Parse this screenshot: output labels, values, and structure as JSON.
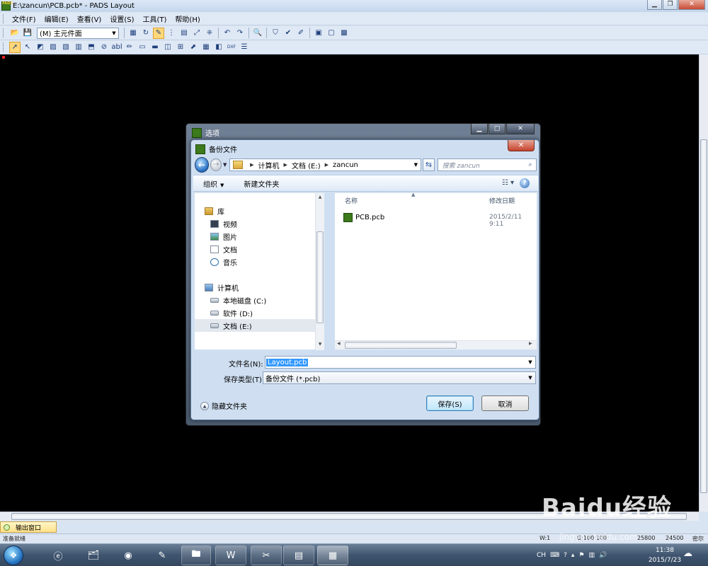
{
  "window": {
    "title": "E:\\zancun\\PCB.pcb* - PADS Layout",
    "app_icon_label": "PADS",
    "controls": [
      "minimize",
      "maximize",
      "close"
    ]
  },
  "menubar": {
    "items": [
      "文件(F)",
      "编辑(E)",
      "查看(V)",
      "设置(S)",
      "工具(T)",
      "帮助(H)"
    ]
  },
  "toolbar1": {
    "layer_combo": "(M) 主元件面"
  },
  "toolbar2": {
    "text_tool_label": "abl",
    "dxf_tool_label": "DXF"
  },
  "options_dialog": {
    "title": "选项"
  },
  "save_dialog": {
    "title": "备份文件",
    "breadcrumb": [
      "计算机",
      "文档 (E:)",
      "zancun"
    ],
    "search_placeholder": "搜索 zancun",
    "commands": {
      "organize": "组织",
      "new_folder": "新建文件夹"
    },
    "nav_tree": [
      {
        "label": "库",
        "icon": "library-icon",
        "level": 0
      },
      {
        "label": "视频",
        "icon": "video-icon",
        "level": 1
      },
      {
        "label": "图片",
        "icon": "picture-icon",
        "level": 1
      },
      {
        "label": "文档",
        "icon": "document-icon",
        "level": 1
      },
      {
        "label": "音乐",
        "icon": "music-icon",
        "level": 1
      },
      {
        "label": "计算机",
        "icon": "computer-icon",
        "level": 0
      },
      {
        "label": "本地磁盘 (C:)",
        "icon": "drive-icon",
        "level": 1
      },
      {
        "label": "软件 (D:)",
        "icon": "drive-icon",
        "level": 1
      },
      {
        "label": "文档 (E:)",
        "icon": "drive-icon",
        "level": 1,
        "selected": true
      }
    ],
    "columns": {
      "name": "名称",
      "modified": "修改日期"
    },
    "files": [
      {
        "name": "PCB.pcb",
        "modified": "2015/2/11 9:11"
      }
    ],
    "file_name_label": "文件名(N):",
    "file_name_value": "Layout.pcb",
    "file_type_label": "保存类型(T):",
    "file_type_value": "备份文件 (*.pcb)",
    "hide_folders": "隐藏文件夹",
    "save_button": "保存(S)",
    "cancel_button": "取消"
  },
  "output_window": {
    "label": "输出窗口"
  },
  "status_bar": {
    "ready": "准备就绪",
    "w": "W:1",
    "g": "G:100 100",
    "x": "25800",
    "y": "24500",
    "unit": "密尔"
  },
  "taskbar": {
    "apps": [
      "ie-icon",
      "explorer-icon",
      "globe-icon",
      "pen-icon",
      "folder-icon",
      "word-icon",
      "tools-icon",
      "pads-router-icon",
      "pads-layout-icon"
    ],
    "tray": {
      "language": "CH"
    },
    "clock_time": "11:38",
    "clock_date": "2015/7/23"
  },
  "watermark": {
    "text": "Baidu经验",
    "url": "jingyan.baidu.com"
  }
}
